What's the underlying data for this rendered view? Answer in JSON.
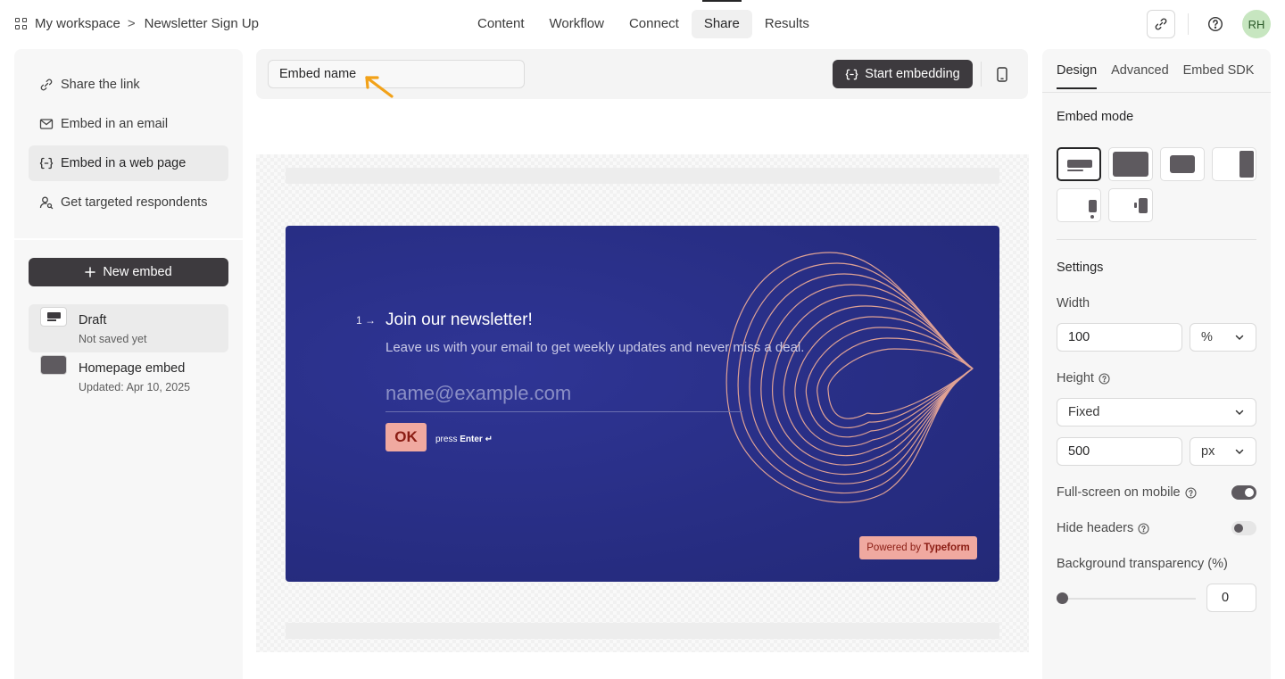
{
  "breadcrumb": {
    "workspace": "My workspace",
    "separator": ">",
    "form": "Newsletter Sign Up"
  },
  "nav_tabs": [
    {
      "label": "Content"
    },
    {
      "label": "Workflow"
    },
    {
      "label": "Connect"
    },
    {
      "label": "Share",
      "active": true
    },
    {
      "label": "Results"
    }
  ],
  "user": {
    "initials": "RH"
  },
  "share_options": [
    {
      "label": "Share the link",
      "icon": "link-icon"
    },
    {
      "label": "Embed in an email",
      "icon": "mail-icon"
    },
    {
      "label": "Embed in a web page",
      "icon": "code-bracket-icon",
      "active": true
    },
    {
      "label": "Get targeted respondents",
      "icon": "person-search-icon"
    }
  ],
  "new_embed_label": "New embed",
  "embeds": [
    {
      "title": "Draft",
      "subtitle": "Not saved yet",
      "active": true
    },
    {
      "title": "Homepage embed",
      "subtitle": "Updated: Apr 10, 2025"
    }
  ],
  "toolbar": {
    "embed_name": "Embed name",
    "start_label": "Start embedding"
  },
  "form_preview": {
    "question_number": "1",
    "title": "Join our newsletter!",
    "subtitle": "Leave us with your email to get weekly updates and never miss a deal.",
    "placeholder": "name@example.com",
    "ok_label": "OK",
    "press_text": "press",
    "enter_text": "Enter ↵",
    "powered_prefix": "Powered by",
    "powered_brand": "Typeform",
    "background_color": "#2a3088",
    "accent_color": "#f0a9a0"
  },
  "right_tabs": [
    {
      "label": "Design",
      "active": true
    },
    {
      "label": "Advanced"
    },
    {
      "label": "Embed SDK"
    }
  ],
  "embed_mode_label": "Embed mode",
  "settings": {
    "title": "Settings",
    "width_label": "Width",
    "width_value": "100",
    "width_unit": "%",
    "height_label": "Height",
    "height_mode": "Fixed",
    "height_value": "500",
    "height_unit": "px",
    "fullscreen_label": "Full-screen on mobile",
    "fullscreen_on": true,
    "hide_headers_label": "Hide headers",
    "hide_headers_on": false,
    "bg_transparency_label": "Background transparency (%)",
    "bg_transparency_value": "0"
  }
}
